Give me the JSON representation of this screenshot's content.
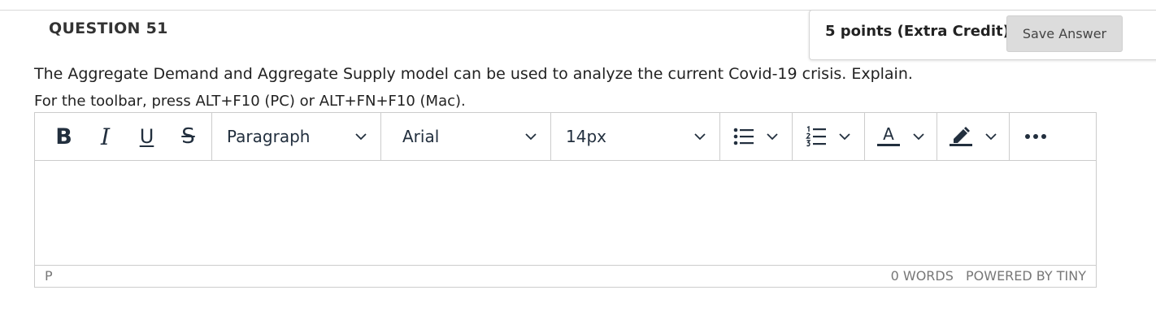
{
  "question": {
    "title": "QUESTION 51",
    "points": "5 points (Extra Credit)",
    "save_label": "Save Answer",
    "text": "The Aggregate Demand and Aggregate Supply model can be used to analyze the current Covid-19 crisis. Explain.",
    "toolbar_hint": "For the toolbar, press ALT+F10 (PC) or ALT+FN+F10 (Mac)."
  },
  "editor": {
    "format_buttons": [
      {
        "label": "B",
        "icon": "bold-icon"
      },
      {
        "label": "I",
        "icon": "italic-icon"
      },
      {
        "label": "U",
        "icon": "underline-icon"
      },
      {
        "label": "S",
        "icon": "strikethrough-icon"
      }
    ],
    "block_format": "Paragraph",
    "font_family": "Arial",
    "font_size": "14px",
    "icons": [
      "bullet-list-icon",
      "numbered-list-icon",
      "text-color-icon",
      "highlight-icon",
      "more-icon"
    ],
    "text_color_glyph": "A",
    "content": "",
    "status": {
      "path": "P",
      "word_count": "0 WORDS",
      "powered_by": "POWERED BY TINY"
    }
  },
  "colors": {
    "icon": "#222f3e",
    "border": "#cccccc",
    "save_button_bg": "#dcdcdc"
  }
}
